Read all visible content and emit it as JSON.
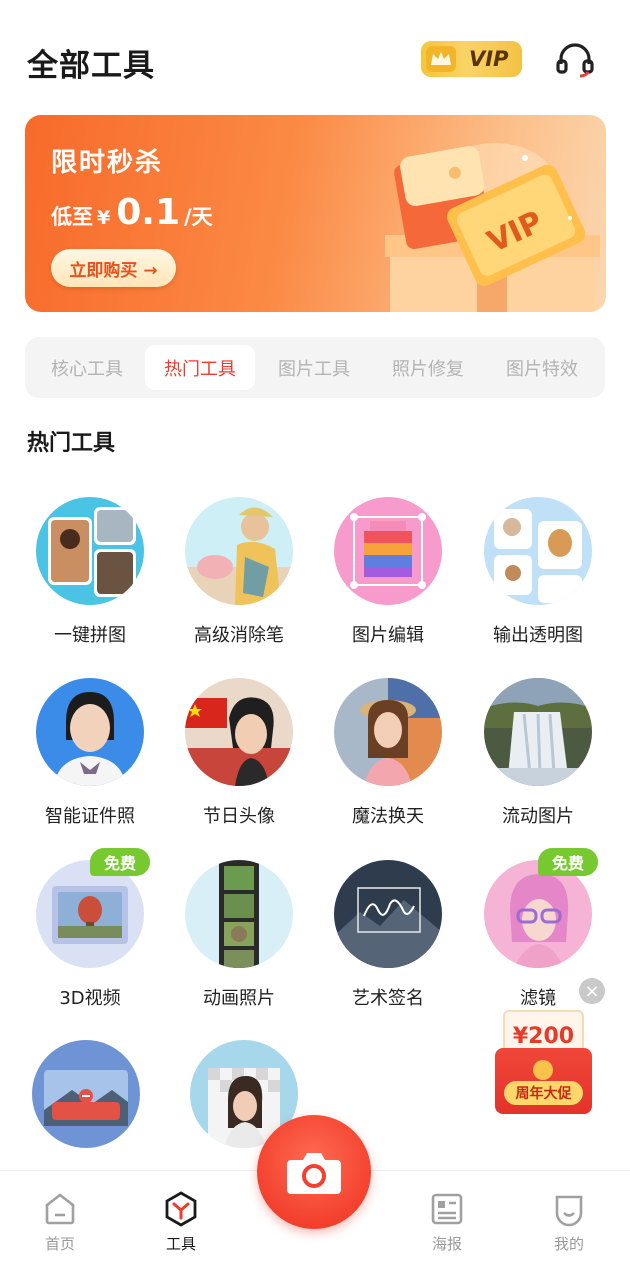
{
  "header": {
    "title": "全部工具",
    "vip_label": "VIP",
    "support_icon": "headset-icon"
  },
  "banner": {
    "title": "限时秒杀",
    "price_prefix": "低至",
    "price_currency": "¥",
    "price_value": "0.1",
    "price_unit": "/天",
    "buy_label": "立即购买 →"
  },
  "tabs": [
    {
      "label": "核心工具",
      "active": false
    },
    {
      "label": "热门工具",
      "active": true
    },
    {
      "label": "图片工具",
      "active": false
    },
    {
      "label": "照片修复",
      "active": false
    },
    {
      "label": "图片特效",
      "active": false
    }
  ],
  "section": {
    "title": "热门工具"
  },
  "tools": [
    {
      "label": "一键拼图",
      "free": false
    },
    {
      "label": "高级消除笔",
      "free": false
    },
    {
      "label": "图片编辑",
      "free": false
    },
    {
      "label": "输出透明图",
      "free": false
    },
    {
      "label": "智能证件照",
      "free": false
    },
    {
      "label": "节日头像",
      "free": false
    },
    {
      "label": "魔法换天",
      "free": false
    },
    {
      "label": "流动图片",
      "free": false
    },
    {
      "label": "3D视频",
      "free": true
    },
    {
      "label": "动画照片",
      "free": false
    },
    {
      "label": "艺术签名",
      "free": false
    },
    {
      "label": "滤镜",
      "free": true
    },
    {
      "label": "",
      "free": false
    },
    {
      "label": "",
      "free": false
    }
  ],
  "free_badge": "免费",
  "promo": {
    "amount": "¥200",
    "label": "周年大促",
    "close_icon": "close-icon"
  },
  "nav": {
    "home": "首页",
    "tools": "工具",
    "poster": "海报",
    "mine": "我的",
    "camera_icon": "camera-icon"
  },
  "colors": {
    "accent": "#ee3a2f",
    "banner": "#f86a2a",
    "vip_gold": "#f7c53c",
    "free_green": "#76c92f"
  }
}
